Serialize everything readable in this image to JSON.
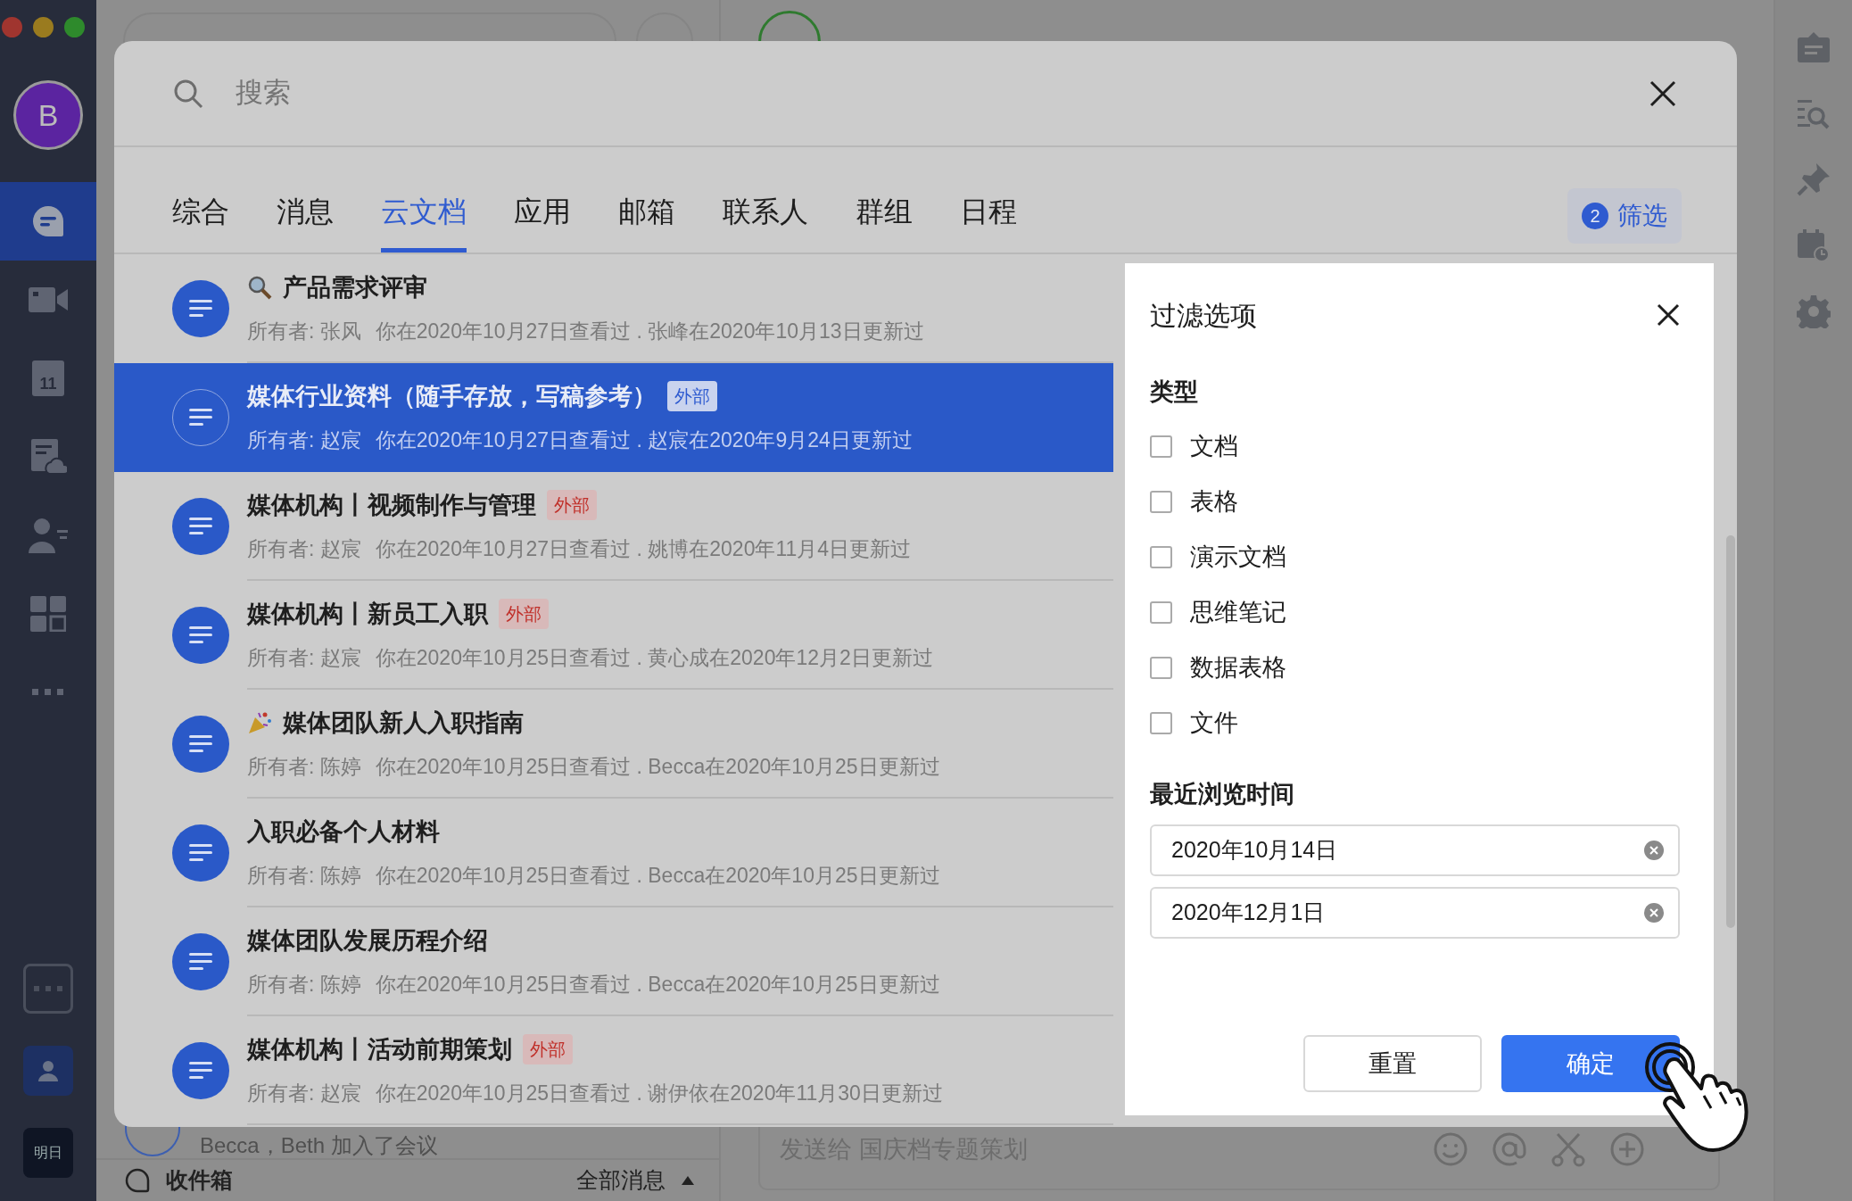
{
  "sidebar": {
    "avatar": "B",
    "nav": [
      {
        "kind": "chat",
        "selected": true
      },
      {
        "kind": "video",
        "selected": false
      },
      {
        "kind": "calendar",
        "label": "11",
        "selected": false
      },
      {
        "kind": "docs",
        "selected": false
      },
      {
        "kind": "contacts",
        "selected": false
      },
      {
        "kind": "apps",
        "selected": false
      },
      {
        "kind": "more",
        "selected": false
      }
    ],
    "bottom_label": "明日"
  },
  "list_pane": {
    "last_item": "Becca，Beth 加入了会议",
    "footer": {
      "label": "收件箱",
      "filter": "全部消息"
    }
  },
  "chat": {
    "composer_placeholder": "发送给 国庆档专题策划"
  },
  "search_modal": {
    "placeholder": "搜索",
    "tabs": [
      {
        "label": "综合",
        "selected": false
      },
      {
        "label": "消息",
        "selected": false
      },
      {
        "label": "云文档",
        "selected": true
      },
      {
        "label": "应用",
        "selected": false
      },
      {
        "label": "邮箱",
        "selected": false
      },
      {
        "label": "联系人",
        "selected": false
      },
      {
        "label": "群组",
        "selected": false
      },
      {
        "label": "日程",
        "selected": false
      }
    ],
    "filter_button": {
      "count": "2",
      "label": "筛选"
    },
    "results": [
      {
        "kind": "found",
        "title": "产品需求评审",
        "owner": "所有者: 张风",
        "activity": "你在2020年10月27日查看过 . 张峰在2020年10月13日更新过",
        "selected": false
      },
      {
        "kind": "plain",
        "title": "媒体行业资料（随手存放，写稿参考）",
        "tag": "外部",
        "owner": "所有者: 赵宸",
        "activity": "你在2020年10月27日查看过 . 赵宸在2020年9月24日更新过",
        "selected": true
      },
      {
        "kind": "plain",
        "title": "媒体机构丨视频制作与管理",
        "tag": "外部",
        "owner": "所有者: 赵宸",
        "activity": "你在2020年10月27日查看过 . 姚博在2020年11月4日更新过",
        "selected": false
      },
      {
        "kind": "plain",
        "title": "媒体机构丨新员工入职",
        "tag": "外部",
        "owner": "所有者: 赵宸",
        "activity": "你在2020年10月25日查看过 . 黄心成在2020年12月2日更新过",
        "selected": false
      },
      {
        "kind": "celebration",
        "title": "媒体团队新人入职指南",
        "owner": "所有者: 陈婷",
        "activity": "你在2020年10月25日查看过 . Becca在2020年10月25日更新过",
        "selected": false
      },
      {
        "kind": "plain",
        "title": "入职必备个人材料",
        "owner": "所有者: 陈婷",
        "activity": "你在2020年10月25日查看过 . Becca在2020年10月25日更新过",
        "selected": false
      },
      {
        "kind": "plain",
        "title": "媒体团队发展历程介绍",
        "owner": "所有者: 陈婷",
        "activity": "你在2020年10月25日查看过 . Becca在2020年10月25日更新过",
        "selected": false
      },
      {
        "kind": "plain",
        "title": "媒体机构丨活动前期策划",
        "tag": "外部",
        "owner": "所有者: 赵宸",
        "activity": "你在2020年10月25日查看过 . 谢伊依在2020年11月30日更新过",
        "selected": false
      }
    ],
    "filter_panel": {
      "title": "过滤选项",
      "sections": [
        {
          "kind": "checkboxes",
          "title": "类型",
          "options": [
            {
              "label": "文档",
              "checked": false
            },
            {
              "label": "表格",
              "checked": false
            },
            {
              "label": "演示文档",
              "checked": false
            },
            {
              "label": "思维笔记",
              "checked": false
            },
            {
              "label": "数据表格",
              "checked": false
            },
            {
              "label": "文件",
              "checked": false
            }
          ]
        },
        {
          "kind": "dates",
          "title": "最近浏览时间",
          "values": [
            "2020年10月14日",
            "2020年12月1日"
          ]
        }
      ],
      "reset": "重置",
      "confirm": "确定"
    }
  }
}
